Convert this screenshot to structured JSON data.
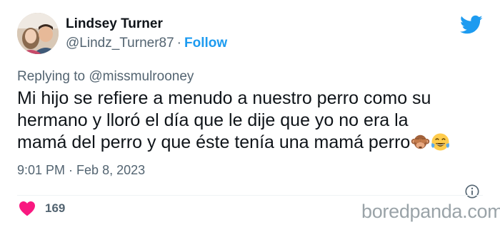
{
  "author": {
    "name": "Lindsey Turner",
    "handle": "@Lindz_Turner87",
    "separator": "·",
    "follow_label": "Follow",
    "avatar_icon": "profile-photo"
  },
  "brand_icon": "twitter-bird-icon",
  "reply": {
    "prefix": "Replying to",
    "mention": "@missmulrooney"
  },
  "tweet": {
    "line1": "Mi hijo se refiere a menudo a nuestro perro como su",
    "line2": "hermano y lloró el día que le dije que yo no era la",
    "line3": "mamá del perro y que éste tenía una mamá perro",
    "emojis": [
      "see-no-evil-monkey",
      "face-with-tears-of-joy"
    ]
  },
  "meta": {
    "time": "9:01 PM",
    "separator": "·",
    "date": "Feb 8, 2023"
  },
  "engagement": {
    "likes": "169"
  },
  "watermark": "boredpanda.com",
  "colors": {
    "text": "#0f1419",
    "secondary": "#536471",
    "accent": "#1d9bf0",
    "heart": "#f91880",
    "watermark": "#9aa3a8"
  }
}
